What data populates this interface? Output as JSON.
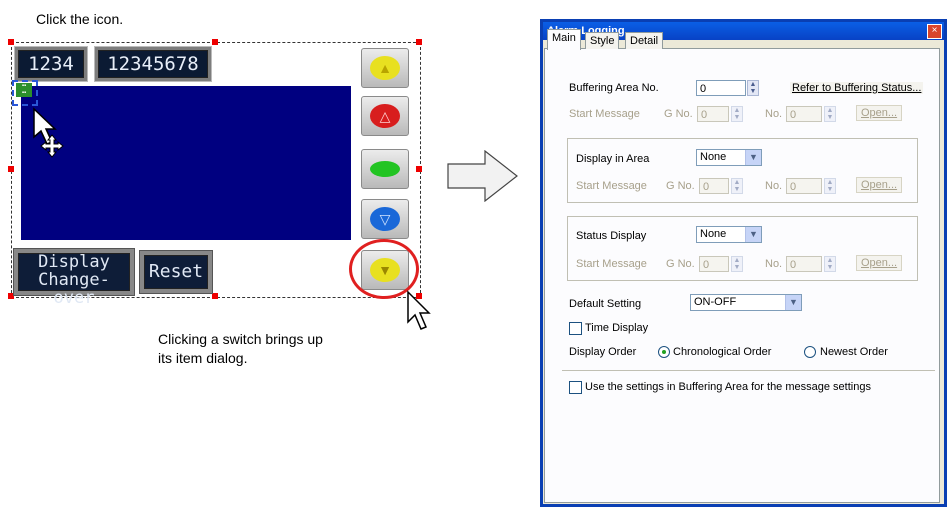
{
  "instruction": "Click the icon.",
  "caption_line1": "Clicking a switch brings up",
  "caption_line2": "its item dialog.",
  "screen_preview": {
    "lcd1": "1234",
    "lcd2": "12345678",
    "display_btn_line1": "Display",
    "display_btn_line2": "Change-over",
    "reset_btn": "Reset",
    "lamps": [
      {
        "color": "#e8e020",
        "symbol": "▲"
      },
      {
        "color": "#d81e1e",
        "symbol": "△"
      },
      {
        "color": "#22c422",
        "symbol": ""
      },
      {
        "color": "#1a68d8",
        "symbol": "▽"
      },
      {
        "color": "#e8e020",
        "symbol": "▼"
      }
    ],
    "highlight_color": "#e02020"
  },
  "dialog": {
    "title": "Alarm Logging",
    "close": "×",
    "tabs": [
      "Main",
      "Style",
      "Detail"
    ],
    "buffering_area_label": "Buffering Area No.",
    "buffering_area_value": "0",
    "refer_link": "Refer to Buffering Status...",
    "start_message_label": "Start Message",
    "g_no_label": "G No.",
    "no_label": "No.",
    "g_no_value": "0",
    "no_value": "0",
    "open_label": "Open...",
    "display_in_area_label": "Display in Area",
    "display_in_area_value": "None",
    "status_display_label": "Status Display",
    "status_display_value": "None",
    "default_setting_label": "Default Setting",
    "default_setting_value": "ON-OFF",
    "time_display_label": "Time Display",
    "display_order_label": "Display Order",
    "chronological_label": "Chronological Order",
    "newest_label": "Newest Order",
    "use_settings_label": "Use the settings in Buffering Area for the message settings"
  }
}
